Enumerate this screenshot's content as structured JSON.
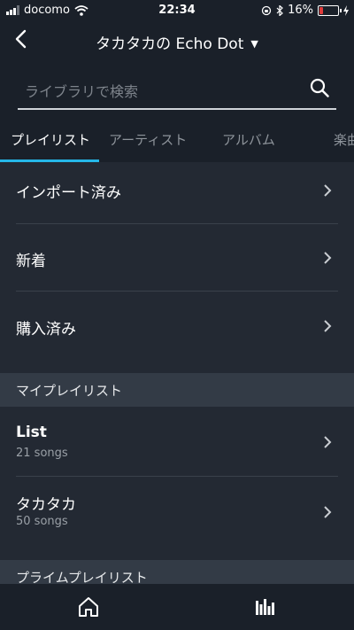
{
  "status": {
    "carrier": "docomo",
    "time": "22:34",
    "battery": "16%"
  },
  "header": {
    "title": "タカタカの Echo Dot"
  },
  "search": {
    "placeholder": "ライブラリで検索"
  },
  "tabs": [
    {
      "label": "プレイリスト",
      "active": true
    },
    {
      "label": "アーティスト",
      "active": false
    },
    {
      "label": "アルバム",
      "active": false
    },
    {
      "label": "楽曲",
      "active": false
    }
  ],
  "rows": [
    {
      "label": "インポート済み"
    },
    {
      "label": "新着"
    },
    {
      "label": "購入済み"
    }
  ],
  "my_playlists": {
    "heading": "マイプレイリスト",
    "items": [
      {
        "label": "List",
        "sub": "21 songs"
      },
      {
        "label": "タカタカ",
        "sub": "50 songs"
      }
    ]
  },
  "prime_playlists": {
    "heading": "プライムプレイリスト"
  },
  "colors": {
    "accent": "#25b7e8",
    "background": "#1a2029",
    "list_background": "#232933",
    "section_background": "#333b46"
  }
}
